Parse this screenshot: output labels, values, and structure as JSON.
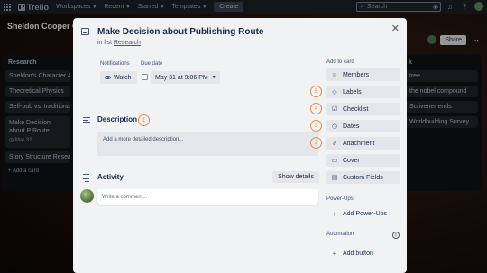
{
  "topbar": {
    "brand": "Trello",
    "nav": [
      {
        "label": "Workspaces"
      },
      {
        "label": "Recent"
      },
      {
        "label": "Starred"
      },
      {
        "label": "Templates"
      }
    ],
    "create_label": "Create",
    "search_placeholder": "Search"
  },
  "board": {
    "title": "Sheldon Cooper C",
    "share_label": "Share"
  },
  "left_list": {
    "title": "Research",
    "cards": [
      {
        "text": "Sheldon's Character Ar"
      },
      {
        "text": "Theoretical Physics"
      },
      {
        "text": "Self-pub vs. traditional"
      },
      {
        "text": "Make Decision about P Route",
        "date": "Mar 31"
      },
      {
        "text": "Story Structure Researc"
      }
    ],
    "add_card": "+ Add a card"
  },
  "right_list": {
    "title": "k",
    "cards": [
      {
        "text": "tree"
      },
      {
        "text": "the nobel compound"
      },
      {
        "text": "Scrivener ends"
      },
      {
        "text": "Worldbuilding Survey"
      }
    ]
  },
  "modal": {
    "title": "Make Decision about Publishing Route",
    "in_list_prefix": "in list",
    "in_list_name": "Research",
    "notifications_label": "Notifications",
    "watch_label": "Watch",
    "due_date_label": "Due date",
    "due_date_value": "May 31 at 9:06 PM",
    "description_title": "Description",
    "description_placeholder": "Add a more detailed description...",
    "activity_title": "Activity",
    "show_details_label": "Show details",
    "comment_placeholder": "Write a comment...",
    "sidebar": {
      "add_to_card_label": "Add to card",
      "buttons": [
        {
          "label": "Members",
          "icon": "person-icon"
        },
        {
          "label": "Labels",
          "icon": "tag-icon"
        },
        {
          "label": "Checklist",
          "icon": "checkbox-icon"
        },
        {
          "label": "Dates",
          "icon": "clock-icon"
        },
        {
          "label": "Attachment",
          "icon": "paperclip-icon"
        },
        {
          "label": "Cover",
          "icon": "cover-icon"
        },
        {
          "label": "Custom Fields",
          "icon": "custom-fields-icon"
        }
      ],
      "powerups_label": "Power-Ups",
      "add_powerups_label": "Add Power-Ups",
      "automation_label": "Automation",
      "add_button_label": "Add button"
    },
    "annotations": {
      "description": "1",
      "labels": "5",
      "checklist": "4",
      "dates": "3",
      "attachment": "2"
    }
  },
  "colors": {
    "annotation": "#f0883e",
    "modal_bg": "#f1f2f4",
    "topbar_bg": "#1d2125"
  }
}
